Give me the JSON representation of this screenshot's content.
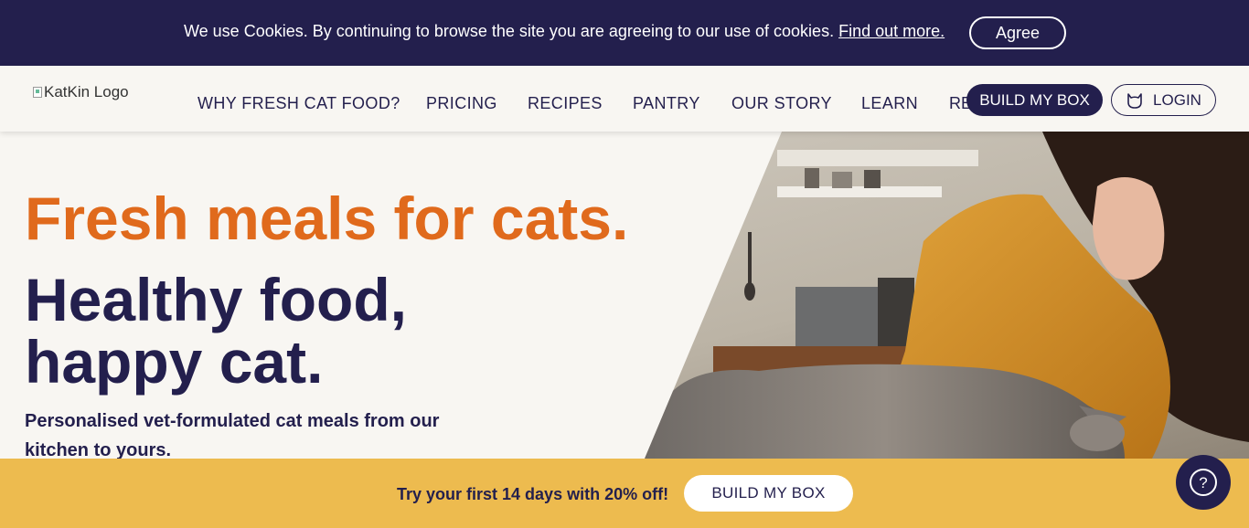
{
  "cookie": {
    "message": "We use Cookies. By continuing to browse the site you are agreeing to our use of cookies.",
    "link_label": "Find out more.",
    "agree_label": "Agree"
  },
  "header": {
    "logo_alt": "KatKin Logo",
    "nav": [
      "WHY FRESH CAT FOOD?",
      "PRICING",
      "RECIPES",
      "PANTRY",
      "OUR STORY",
      "LEARN",
      "RE"
    ],
    "build_label": "BUILD MY BOX",
    "login_label": "LOGIN"
  },
  "hero": {
    "title_orange": "Fresh meals for cats.",
    "title_navy": "Healthy food, happy cat.",
    "subtitle": "Personalised vet-formulated cat meals from our kitchen to yours."
  },
  "promo": {
    "text": "Try your first 14 days with 20% off!",
    "button_label": "BUILD MY BOX"
  },
  "help": {
    "icon": "question-mark-icon",
    "symbol": "?"
  },
  "colors": {
    "navy": "#231f4d",
    "orange": "#e06a1c",
    "cream": "#f8f6f2",
    "mustard": "#edbb4f"
  }
}
